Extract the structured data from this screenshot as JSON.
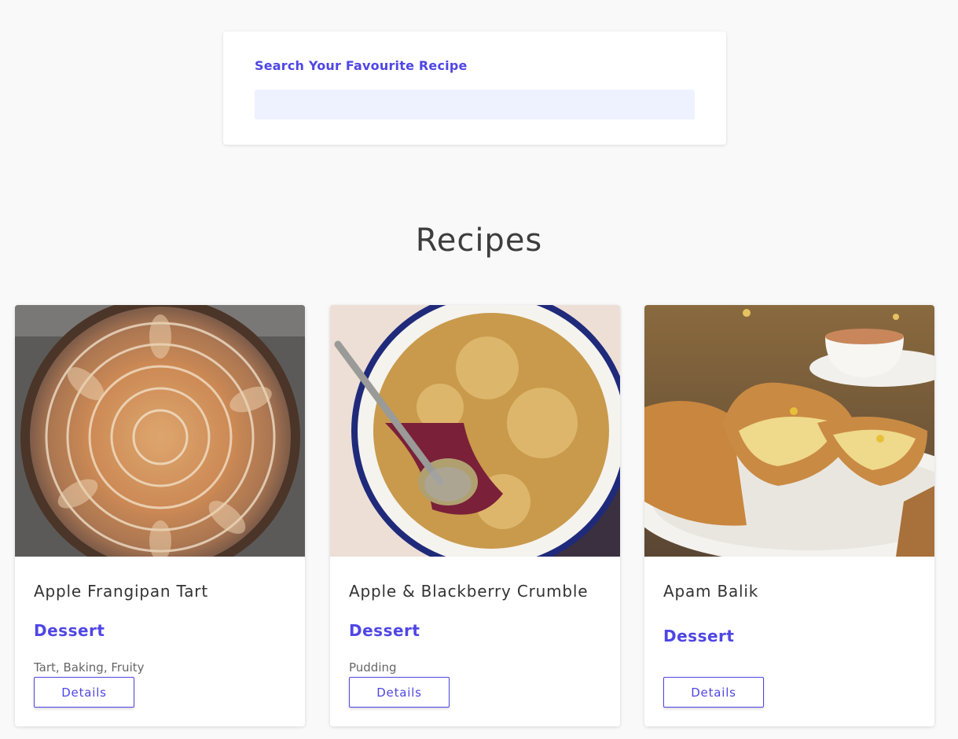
{
  "search": {
    "label": "Search Your Favourite Recipe",
    "value": "",
    "placeholder": ""
  },
  "section": {
    "title": "Recipes"
  },
  "recipes": [
    {
      "title": "Apple Frangipan Tart",
      "category": "Dessert",
      "tags": "Tart, Baking, Fruity",
      "button_label": "Details"
    },
    {
      "title": "Apple & Blackberry Crumble",
      "category": "Dessert",
      "tags": "Pudding",
      "button_label": "Details"
    },
    {
      "title": "Apam Balik",
      "category": "Dessert",
      "tags": "",
      "button_label": "Details"
    }
  ],
  "colors": {
    "accent": "#4f46e5",
    "input_bg": "#eef2ff",
    "page_bg": "#f9f9f9"
  }
}
